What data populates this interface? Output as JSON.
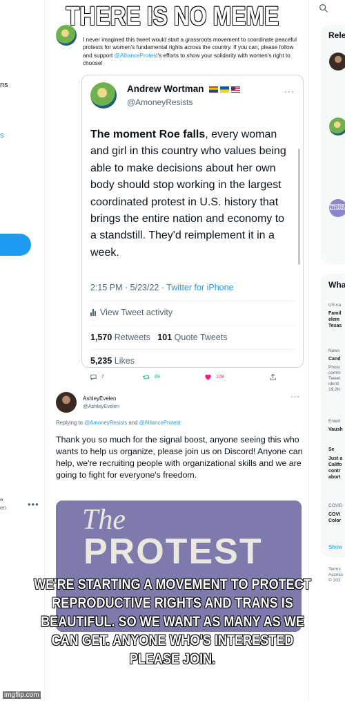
{
  "meme": {
    "top_text": "THERE IS NO MEME",
    "bottom_text": "WE'RE STARTING A MOVEMENT TO PROTECT REPRODUCTIVE RIGHTS AND TRANS IS BEAUTIFUL. SO WE WANT AS MANY AS WE CAN GET. ANYONE WHO'S INTERESTED PLEASE JOIN.",
    "watermark": "imgflip.com"
  },
  "left_rail": {
    "fragment_1": "ns",
    "fragment_2": "s",
    "profile_fragment_1": "a",
    "profile_fragment_2": "en",
    "more_dots": "•••"
  },
  "top_tweet": {
    "text_before_link": "I never imagined this tweet would start a grassroots movement to coordinate peaceful protests for women's fundamental rights across the country. If you can, please follow and support ",
    "link": "@AllianceProtest",
    "text_after_link": "'s efforts to show your solidarity with women's right to choose!"
  },
  "quoted_tweet": {
    "name": "Andrew Wortman",
    "handle": "@AmoneyResists",
    "more": "···",
    "body_bold": "The moment Roe falls",
    "body_rest": ", every woman and girl in this country who values being able to make decisions about her own body should stop working in the largest coordinated protest in U.S. history that brings the entire nation and economy to a standstill. They'd reimplement it in a week.",
    "time": "2:15 PM · 5/23/22 · ",
    "source": "Twitter for iPhone",
    "activity": "View Tweet activity",
    "retweets_count": "1,570",
    "retweets_label": "Retweets",
    "quotes_count": "101",
    "quotes_label": "Quote Tweets",
    "likes_count": "5,235",
    "likes_label": "Likes"
  },
  "action_bar": {
    "replies": "7",
    "retweets": "69",
    "likes": "109"
  },
  "reply": {
    "name": "AshleyEvelen",
    "handle": "@AshleyEvelen",
    "more": "···",
    "replying_prefix": "Replying to ",
    "replying_to_1": "@AmoneyResists",
    "replying_and": " and ",
    "replying_to_2": "@AllianceProtest",
    "body": "Thank you so much for the signal boost, anyone seeing this who wants to help us organize, please join us on Discord! Anyone can help, we're recruiting people with organizational skills and we are going to fight for everyone's freedom.",
    "image_the": "The",
    "image_word": "PROTEST"
  },
  "right_rail": {
    "relevant_head": "Rele",
    "avatar_label": "PROTEST ALLIANCE",
    "whats_head": "Wha",
    "trend_1_meta": "US na",
    "trend_1_title": "Famil\nelem\nTexas",
    "trend_2_meta": "News",
    "trend_2_title": "Cand",
    "trend_2_desc": "Photo\ncomm\nTweet\nidenti\n19.2K",
    "trend_3_meta": "Entert",
    "trend_3_title": "Vaush",
    "trend_4_meta": "Se",
    "trend_4_title": "Just a\nCalifo\ncontr\nabort",
    "trend_5_meta": "COVID",
    "trend_5_title": "COVI\nColor",
    "show_more": "Show",
    "footer": "Terms\nAccess\n© 202"
  },
  "colors": {
    "accent_blue": "#1d9bf0",
    "retweet_green": "#00ba7c",
    "like_pink": "#f91880",
    "muted_text": "#536471"
  }
}
